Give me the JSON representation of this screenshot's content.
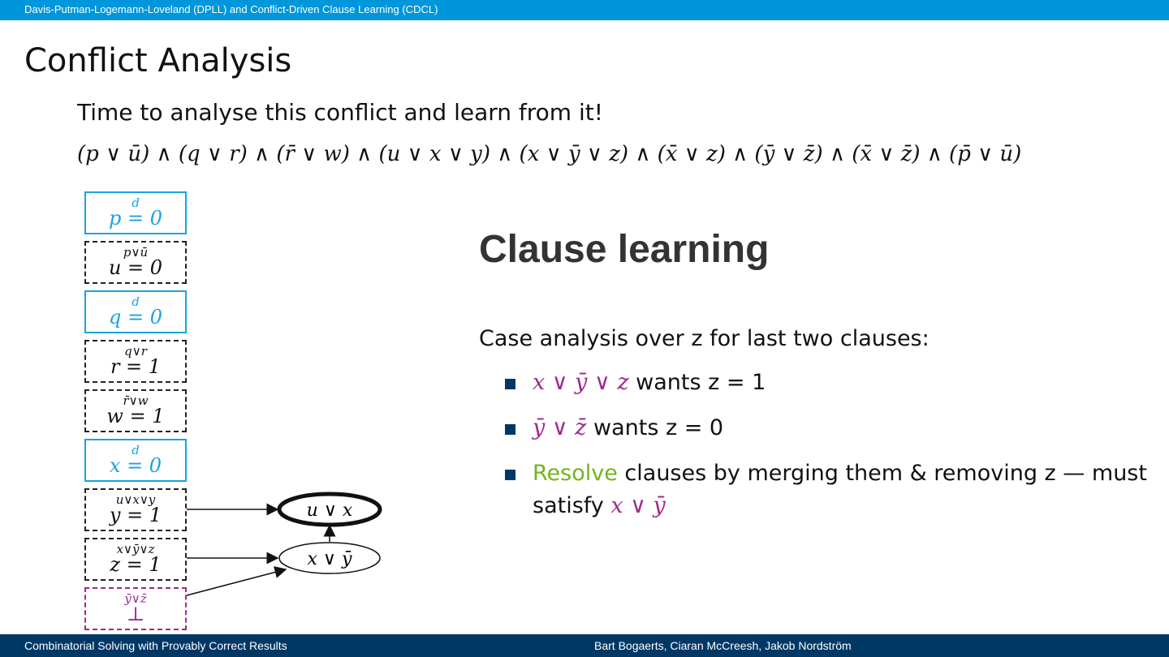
{
  "header": {
    "breadcrumb": "Davis-Putman-Logemann-Loveland (DPLL) and Conflict-Driven Clause Learning (CDCL)"
  },
  "slide": {
    "title": "Conflict Analysis",
    "intro": "Time to analyse this conflict and learn from it!",
    "formula": {
      "clauses": [
        "p ∨ ū",
        "q ∨ r",
        "r̄ ∨ w",
        "u ∨ x ∨ y",
        "x ∨ ȳ ∨ z",
        "x̄ ∨ z",
        "ȳ ∨ z̄",
        "x̄ ∨ z̄",
        "p̄ ∨ ū"
      ]
    },
    "trail": [
      {
        "type": "decision",
        "assignment": "p = 0",
        "reason": "d"
      },
      {
        "type": "propagation",
        "assignment": "u = 0",
        "reason": "p∨ū"
      },
      {
        "type": "decision",
        "assignment": "q = 0",
        "reason": "d"
      },
      {
        "type": "propagation",
        "assignment": "r = 1",
        "reason": "q∨r"
      },
      {
        "type": "propagation",
        "assignment": "w = 1",
        "reason": "r̄∨w"
      },
      {
        "type": "decision",
        "assignment": "x = 0",
        "reason": "d"
      },
      {
        "type": "propagation",
        "assignment": "y = 1",
        "reason": "u∨x∨y"
      },
      {
        "type": "propagation",
        "assignment": "z = 1",
        "reason": "x∨ȳ∨z"
      },
      {
        "type": "conflict",
        "assignment": "⊥",
        "reason": "ȳ∨z̄"
      }
    ],
    "graph_nodes": {
      "learned": "u ∨ x",
      "intermediate": "x ∨ ȳ"
    },
    "section_heading": "Clause learning",
    "paragraph": "Case analysis over z for last two clauses:",
    "bullets": [
      {
        "clause": "x ∨ ȳ ∨ z",
        "text": " wants z = 1"
      },
      {
        "clause": "ȳ ∨ z̄",
        "text": " wants z = 0"
      },
      {
        "highlight": "Resolve",
        "text": " clauses by merging them & removing z — must satisfy ",
        "clause": "x ∨ ȳ"
      }
    ]
  },
  "footer": {
    "left": "Combinatorial Solving with Provably Correct Results",
    "right": "Bart Bogaerts, Ciaran McCreesh, Jakob Nordström"
  },
  "colors": {
    "topbar": "#0096dc",
    "footer": "#003865",
    "decision": "#1aa3e0",
    "conflict": "#a0298f",
    "highlight": "#73b41e",
    "bullet": "#003865"
  }
}
